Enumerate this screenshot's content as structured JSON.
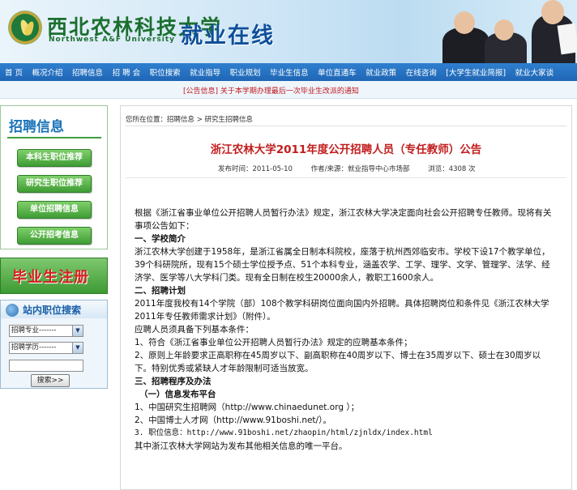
{
  "header": {
    "university_name": "西北农林科技大学",
    "university_en": "Northwest A&F University",
    "site_title": "就业在线"
  },
  "nav": {
    "items": [
      "首 页",
      "概况介绍",
      "招聘信息",
      "招 聘 会",
      "职位搜索",
      "就业指导",
      "职业规划",
      "毕业生信息",
      "单位直通车",
      "就业政策",
      "在线咨询",
      "[大学生就业简报]",
      "就业大家谈"
    ]
  },
  "notice": {
    "text": "[公告信息] 关于本学期办理最后一次毕业生改派的通知"
  },
  "sidebar": {
    "recruit_title": "招聘信息",
    "buttons": [
      "本科生职位推荐",
      "研究生职位推荐",
      "单位招聘信息",
      "公开招考信息"
    ],
    "graduate_banner": "毕业生注册",
    "search": {
      "title": "站内职位搜索",
      "major_select": "招聘专业-------",
      "degree_select": "招聘学历-------",
      "button": "搜索>>"
    }
  },
  "main": {
    "breadcrumb": "您所在位置：招聘信息 > 研究生招聘信息",
    "title": "浙江农林大学2011年度公开招聘人员（专任教师）公告",
    "meta": {
      "date": "发布时间：2011-05-10",
      "author": "作者/来源：就业指导中心市场部",
      "views": "浏览：4308 次"
    },
    "paragraphs": [
      {
        "text": "根据《浙江省事业单位公开招聘人员暂行办法》规定，浙江农林大学决定面向社会公开招聘专任教师。现将有关事项公告如下：",
        "style": ""
      },
      {
        "text": "一、学校简介",
        "style": "h"
      },
      {
        "text": "浙江农林大学创建于1958年，是浙江省属全日制本科院校，座落于杭州西郊临安市。学校下设17个教学单位，39个科研院所，现有15个硕士学位授予点、51个本科专业，涵盖农学、工学、理学、文学、管理学、法学、经济学、医学等八大学科门类。现有全日制在校生20000余人，教职工1600余人。",
        "style": ""
      },
      {
        "text": "二、招聘计划",
        "style": "h"
      },
      {
        "text": "2011年度我校有14个学院（部）108个教学科研岗位面向国内外招聘。具体招聘岗位和条件见《浙江农林大学2011年专任教师需求计划》（附件）。",
        "style": ""
      },
      {
        "text": "应聘人员须具备下列基本条件：",
        "style": ""
      },
      {
        "text": "1、符合《浙江省事业单位公开招聘人员暂行办法》规定的应聘基本条件；",
        "style": ""
      },
      {
        "text": "2、原则上年龄要求正高职称在45周岁以下、副高职称在40周岁以下、博士在35周岁以下、硕士在30周岁以下。特别优秀或紧缺人才年龄限制可适当放宽。",
        "style": ""
      },
      {
        "text": "三、招聘程序及办法",
        "style": "h"
      },
      {
        "text": "（一）信息发布平台",
        "style": "h"
      },
      {
        "text": "1、中国研究生招聘网（http://www.chinaedunet.org ）；",
        "style": ""
      },
      {
        "text": "2、中国博士人才网（http://www.91boshi.net/）。",
        "style": ""
      },
      {
        "text": "3. 职位信息：http://www.91boshi.net/zhaopin/html/zjnldx/index.html",
        "style": ""
      },
      {
        "text": "其中浙江农林大学网站为发布其他相关信息的唯一平台。",
        "style": ""
      }
    ]
  }
}
